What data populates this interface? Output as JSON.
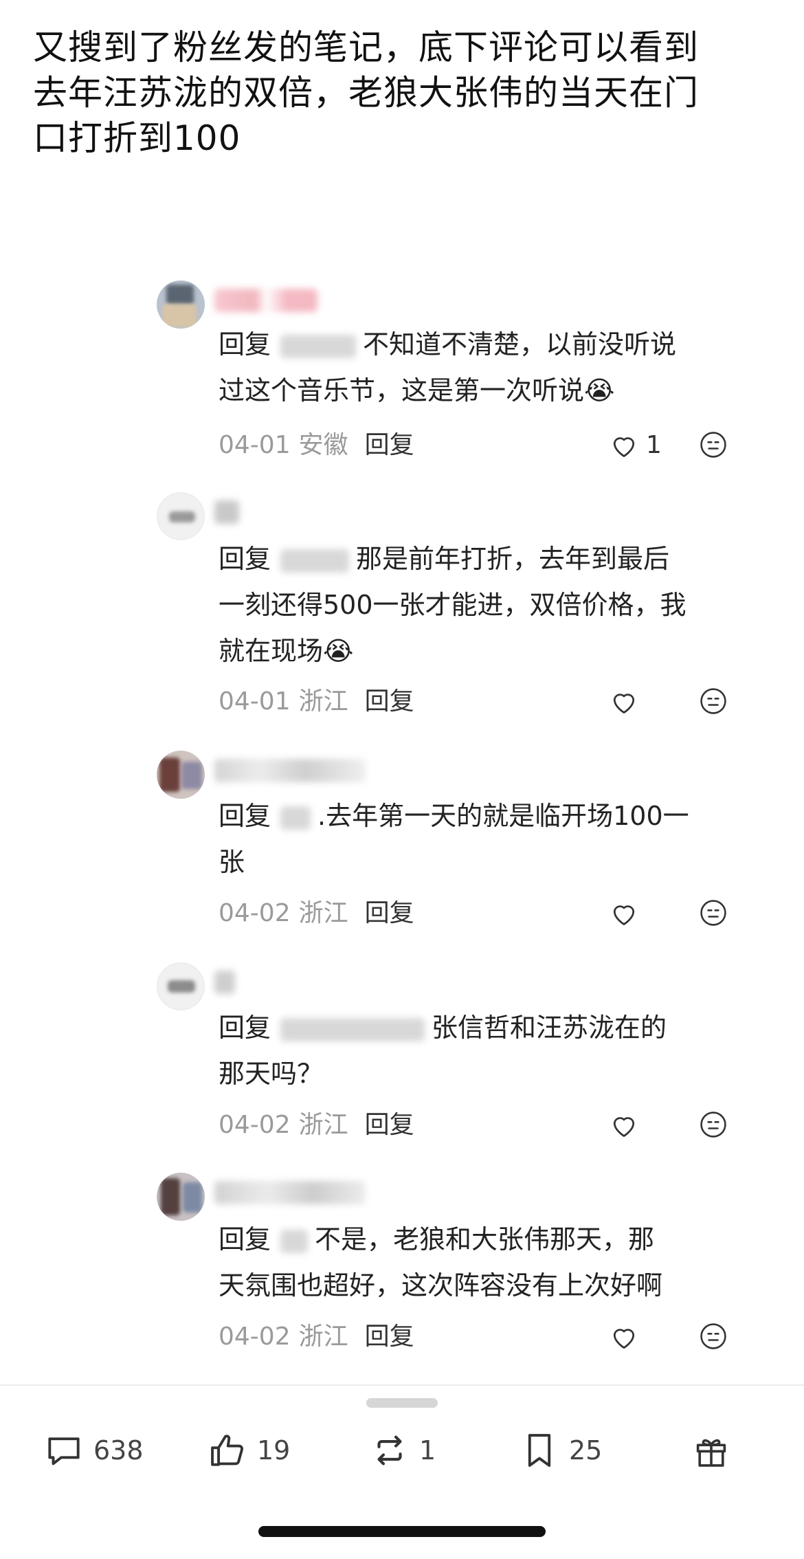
{
  "post": {
    "lines": [
      "又搜到了粉丝发的笔记，底下评论可以看到",
      "去年汪苏泷的双倍，老狼大张伟的当天在门",
      "口打折到100"
    ]
  },
  "comments": [
    {
      "reply_prefix": "回复",
      "reply_target": "随...",
      "lines": [
        "不知道不清楚，以前没听说",
        "过这个音乐节，这是第一次听说😭"
      ],
      "date": "04-01",
      "location": "安徽",
      "reply_label": "回复",
      "likes": "1"
    },
    {
      "reply_prefix": "回复",
      "reply_target": "",
      "lines": [
        "那是前年打折，去年到最后",
        "一刻还得500一张才能进，双倍价格，我",
        "就在现场😭"
      ],
      "date": "04-01",
      "location": "浙江",
      "reply_label": "回复",
      "likes": ""
    },
    {
      "reply_prefix": "回复",
      "reply_target": "",
      "lines": [
        ".去年第一天的就是临开场100一",
        "张"
      ],
      "date": "04-02",
      "location": "浙江",
      "reply_label": "回复",
      "likes": ""
    },
    {
      "reply_prefix": "回复",
      "reply_target": "",
      "lines": [
        "张信哲和汪苏泷在的",
        "那天吗？"
      ],
      "date": "04-02",
      "location": "浙江",
      "reply_label": "回复",
      "likes": ""
    },
    {
      "reply_prefix": "回复",
      "reply_target": "",
      "lines": [
        "不是，老狼和大张伟那天，那",
        "天氛围也超好，这次阵容没有上次好啊"
      ],
      "date": "04-02",
      "location": "浙江",
      "reply_label": "回复",
      "likes": ""
    }
  ],
  "bottom_bar": {
    "comments": "638",
    "likes": "19",
    "reposts": "1",
    "favorites": "25"
  }
}
